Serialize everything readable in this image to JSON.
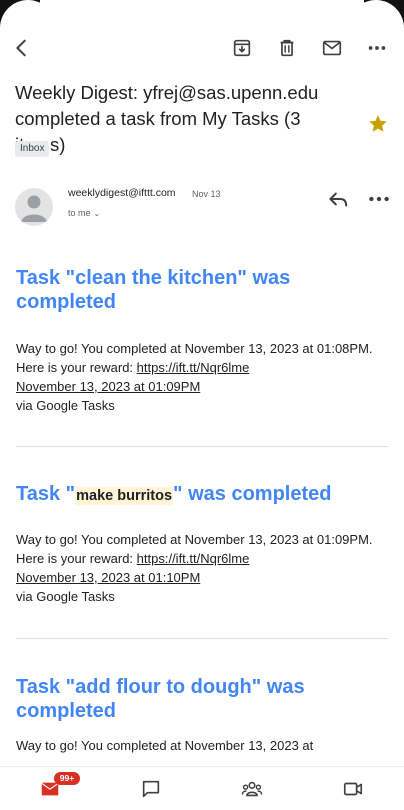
{
  "toolbar": {
    "back": "back-icon",
    "archive": "archive-icon",
    "delete": "delete-icon",
    "mark_unread": "mail-icon",
    "more": "more-icon"
  },
  "email": {
    "subject": "Weekly Digest: yfrej@sas.upenn.edu completed a task from My Tasks (3 items)",
    "label": "Inbox",
    "starred": true,
    "sender": "weeklydigest@ifttt.com",
    "date": "Nov 13",
    "recipient": "to me"
  },
  "tasks": [
    {
      "title_prefix": "Task \"clean the kitchen\" was completed",
      "body_text": "Way to go! You completed at November 13, 2023 at 01:08PM. Here is your reward: ",
      "reward_link": "https://ift.tt/Nqr6lme",
      "date_link": "November 13, 2023 at 01:09PM",
      "via": "via Google Tasks"
    },
    {
      "title_pre": "Task \"",
      "title_highlight": "make burritos",
      "title_post": "\" was completed",
      "body_text": "Way to go! You completed at November 13, 2023 at 01:09PM. Here is your reward: ",
      "reward_link": "https://ift.tt/Nqr6lme",
      "date_link": "November 13, 2023 at 01:10PM",
      "via": "via Google Tasks"
    },
    {
      "title_prefix": "Task \"add flour to dough\" was completed",
      "body_text": "Way to go! You completed at November 13, 2023 at"
    }
  ],
  "bottom_nav": {
    "mail_badge": "99+",
    "items": [
      "mail-icon",
      "chat-icon",
      "spaces-icon",
      "meet-icon"
    ]
  },
  "colors": {
    "title_blue": "#4285f4",
    "star_gold": "#c8a000",
    "badge_red": "#d93025",
    "mail_red": "#d93025"
  }
}
